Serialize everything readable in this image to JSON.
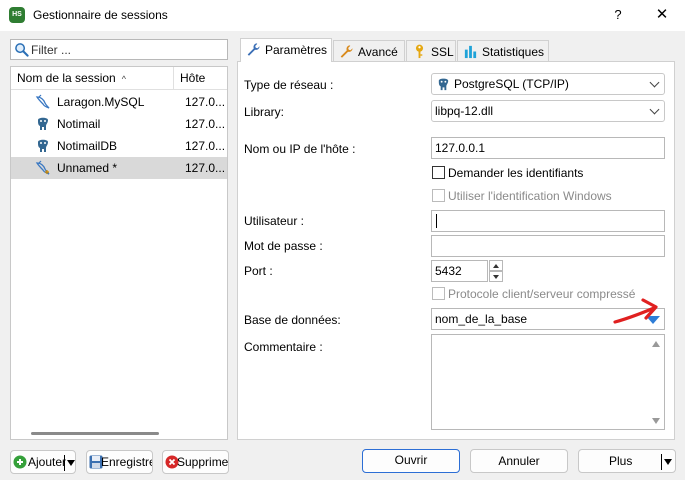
{
  "window": {
    "title": "Gestionnaire de sessions",
    "help_glyph": "?",
    "close_glyph": "✕",
    "app_icon_text": "HS"
  },
  "filter": {
    "placeholder": "Filter ..."
  },
  "session_list": {
    "columns": {
      "name": "Nom de la session",
      "host": "Hôte",
      "sort_glyph": "^"
    },
    "rows": [
      {
        "name": "Laragon.MySQL",
        "host": "127.0...",
        "icon": "dolphin-icon",
        "selected": false
      },
      {
        "name": "Notimail",
        "host": "127.0...",
        "icon": "postgresql-elephant-icon",
        "selected": false
      },
      {
        "name": "NotimailDB",
        "host": "127.0...",
        "icon": "postgresql-elephant-icon",
        "selected": false
      },
      {
        "name": "Unnamed *",
        "host": "127.0...",
        "icon": "dolphin-icon",
        "selected": true
      }
    ]
  },
  "left_buttons": {
    "add": "Ajouter",
    "save": "Enregistrer",
    "delete": "Supprimer"
  },
  "tabs": [
    {
      "label": "Paramètres",
      "icon": "wrench-icon",
      "active": true
    },
    {
      "label": "Avancé",
      "icon": "wrench-orange-icon",
      "active": false
    },
    {
      "label": "SSL",
      "icon": "key-icon",
      "active": false
    },
    {
      "label": "Statistiques",
      "icon": "bar-chart-icon",
      "active": false
    }
  ],
  "form": {
    "network_type": {
      "label": "Type de réseau :",
      "value": "PostgreSQL (TCP/IP)"
    },
    "library": {
      "label": "Library:",
      "value": "libpq-12.dll"
    },
    "host": {
      "label": "Nom ou IP de l'hôte :",
      "value": "127.0.0.1"
    },
    "prompt_credentials": {
      "label": "Demander les identifiants",
      "checked": false
    },
    "windows_auth": {
      "label": "Utiliser l'identification Windows",
      "checked": false,
      "disabled": true
    },
    "user": {
      "label": "Utilisateur :",
      "value": ""
    },
    "password": {
      "label": "Mot de passe :",
      "value": ""
    },
    "port": {
      "label": "Port :",
      "value": "5432"
    },
    "compression": {
      "label": "Protocole client/serveur compressé",
      "checked": false,
      "disabled": true
    },
    "database": {
      "label": "Base de données:",
      "value": "nom_de_la_base"
    },
    "comment": {
      "label": "Commentaire :",
      "value": ""
    }
  },
  "bottom_buttons": {
    "open": "Ouvrir",
    "cancel": "Annuler",
    "more": "Plus"
  },
  "colors": {
    "accent_blue": "#2c6ed5",
    "dropdown_arrow": "#2e7dd7",
    "annotation_red": "#e02020",
    "selected_row": "#d9d9d9"
  }
}
